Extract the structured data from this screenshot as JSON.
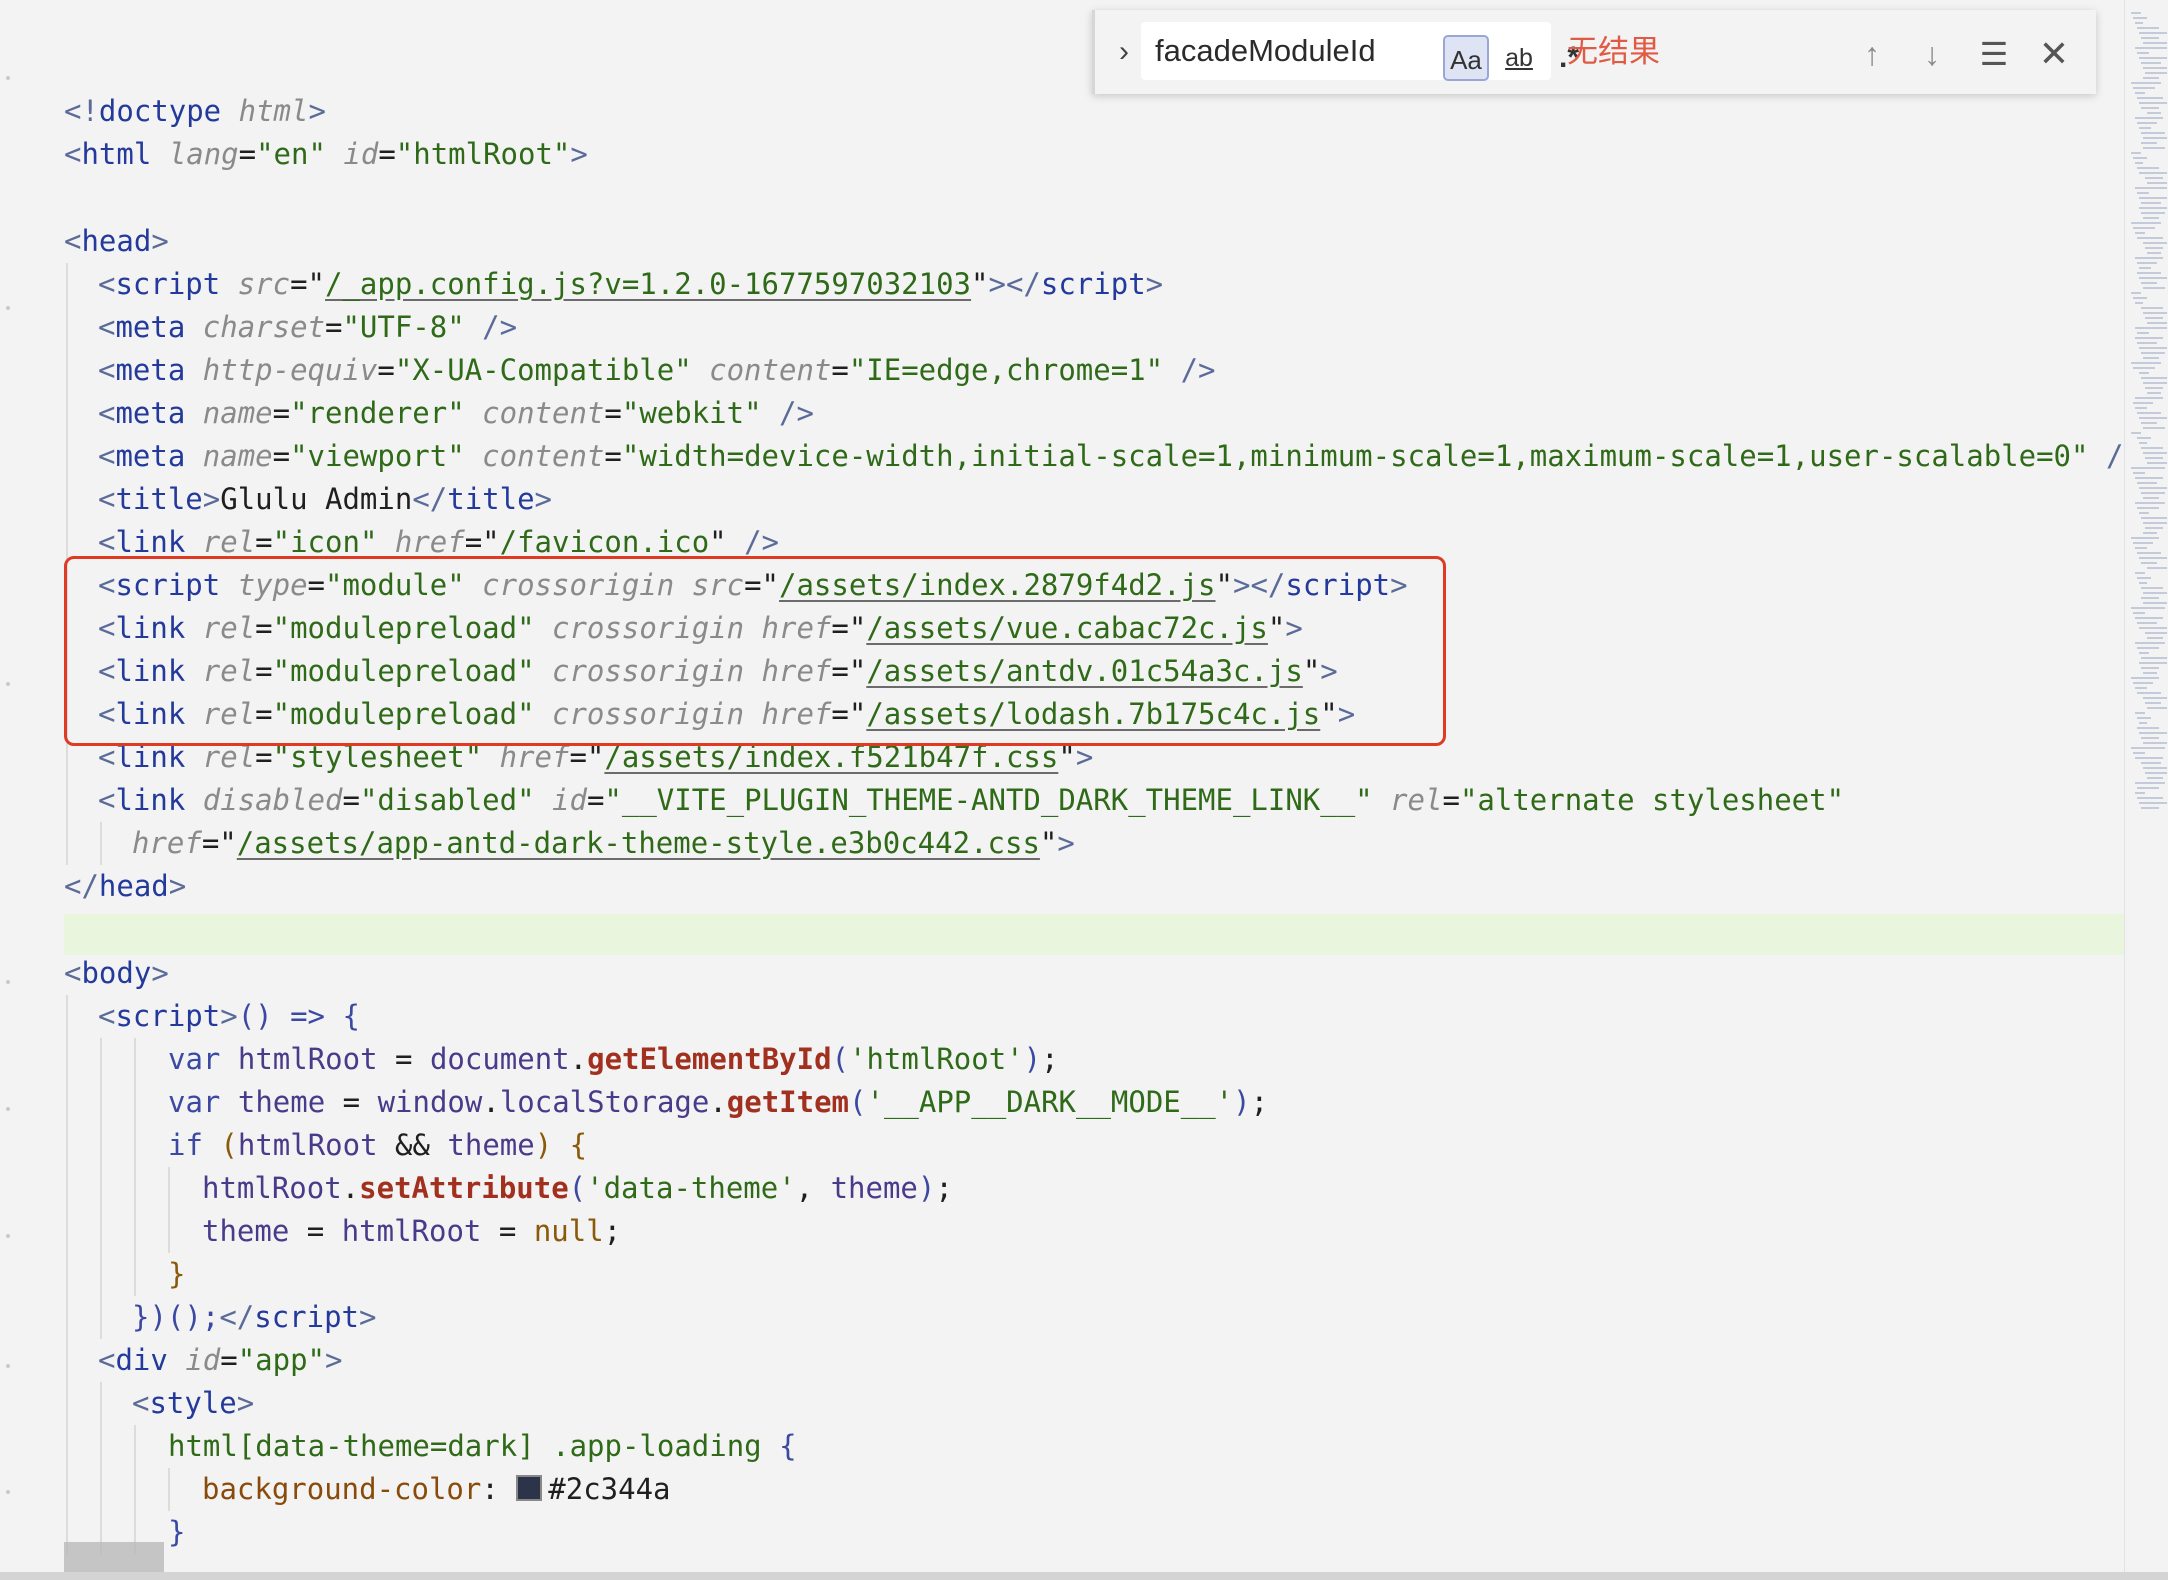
{
  "find_widget": {
    "query": "facadeModuleId",
    "match_case_label": "Aa",
    "whole_word_label": "ab",
    "regex_label": ".*",
    "result_text": "无结果",
    "toggle_icon": "chevron-right-icon",
    "prev_icon": "arrow-up-icon",
    "next_icon": "arrow-down-icon",
    "selection_icon": "find-in-selection-icon",
    "close_icon": "close-icon"
  },
  "code": {
    "doctype_open": "<!",
    "doctype_name": "doctype",
    "doctype_attr": "html",
    "tag_html": "html",
    "attr_lang": "lang",
    "val_en": "\"en\"",
    "attr_id": "id",
    "val_htmlRoot": "\"htmlRoot\"",
    "tag_head": "head",
    "tag_script": "script",
    "attr_src": "src",
    "val_appconfig": "/_app.config.js?v=1.2.0-1677597032103",
    "tag_meta": "meta",
    "attr_charset": "charset",
    "val_utf8": "\"UTF-8\"",
    "attr_httpequiv": "http-equiv",
    "val_xua": "\"X-UA-Compatible\"",
    "attr_content": "content",
    "val_ieedge": "\"IE=edge,chrome=1\"",
    "attr_name": "name",
    "val_renderer": "\"renderer\"",
    "val_webkit": "\"webkit\"",
    "val_viewport": "\"viewport\"",
    "val_viewport_content": "\"width=device-width,initial-scale=1,minimum-scale=1,maximum-scale=1,user-scalable=0\"",
    "tag_title": "title",
    "title_text": "Glulu Admin",
    "tag_link": "link",
    "attr_rel": "rel",
    "val_icon": "\"icon\"",
    "attr_href": "href",
    "val_favicon": "/favicon.ico",
    "attr_type": "type",
    "val_module": "\"module\"",
    "attr_crossorigin": "crossorigin",
    "val_index_js": "/assets/index.2879f4d2.js",
    "val_modulepreload": "\"modulepreload\"",
    "val_vue_js": "/assets/vue.cabac72c.js",
    "val_antdv_js": "/assets/antdv.01c54a3c.js",
    "val_lodash_js": "/assets/lodash.7b175c4c.js",
    "val_stylesheet": "\"stylesheet\"",
    "val_index_css": "/assets/index.f521b47f.css",
    "attr_disabled": "disabled",
    "val_disabled": "\"disabled\"",
    "val_theme_link_id": "\"__VITE_PLUGIN_THEME-ANTD_DARK_THEME_LINK__\"",
    "val_alt_stylesheet": "\"alternate stylesheet\"",
    "val_dark_css": "/assets/app-antd-dark-theme-style.e3b0c442.css",
    "tag_body": "body",
    "iife_open": "() => {",
    "kw_var": "var",
    "id_htmlRoot": "htmlRoot",
    "id_document": "document",
    "fn_getElementById": "getElementById",
    "str_htmlRoot": "'htmlRoot'",
    "id_theme": "theme",
    "id_window": "window",
    "id_localStorage": "localStorage",
    "fn_getItem": "getItem",
    "str_darkmode": "'__APP__DARK__MODE__'",
    "kw_if": "if",
    "op_and": "&&",
    "fn_setAttribute": "setAttribute",
    "str_datatheme": "'data-theme'",
    "kw_null": "null",
    "iife_close": "})();",
    "tag_div": "div",
    "val_app": "\"app\"",
    "tag_style": "style",
    "css_selector": "html[data-theme=dark]",
    "css_class": ".app-loading",
    "css_prop": "background-color",
    "css_value": "#2c344a"
  },
  "colors": {
    "highlight_box": "#e03a22",
    "swatch": "#2c344a",
    "find_result": "#e05a44"
  }
}
